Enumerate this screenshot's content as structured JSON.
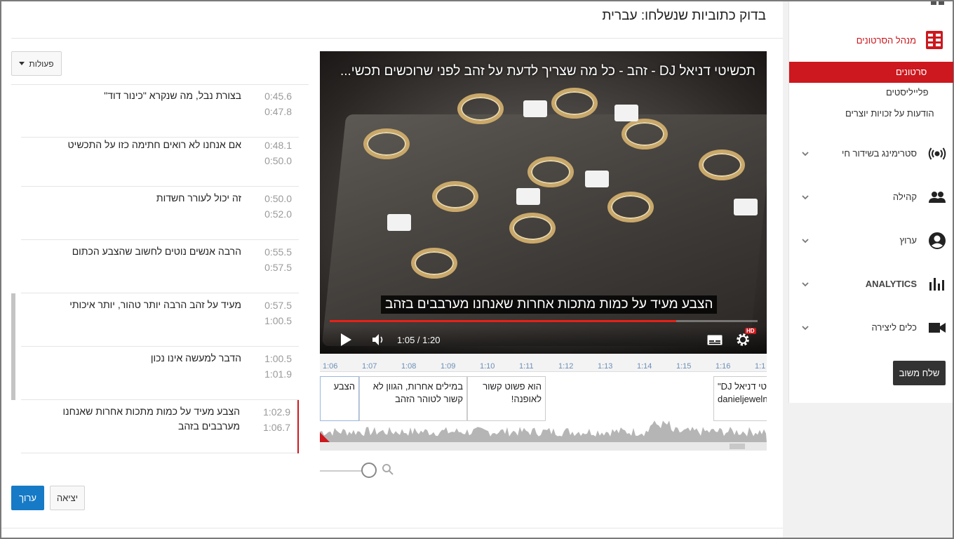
{
  "page": {
    "title": "בדוק כתוביות שנשלחו: עברית",
    "actions_label": "פעולות",
    "exit_label": "יציאה",
    "edit_label": "ערוך"
  },
  "captions": [
    {
      "text": "בצורת נבל, מה שנקרא \"כינור דוד\"",
      "start": "0:45.6",
      "end": "0:47.8"
    },
    {
      "text": "אם אנחנו לא רואים חתימה כזו על התכשיט",
      "start": "0:48.1",
      "end": "0:50.0"
    },
    {
      "text": "זה יכול לעורר חשדות",
      "start": "0:50.0",
      "end": "0:52.0"
    },
    {
      "text": "הרבה אנשים נוטים לחשוב שהצבע הכתום",
      "start": "0:55.5",
      "end": "0:57.5"
    },
    {
      "text": "מעיד על זהב הרבה יותר טהור, יותר איכותי",
      "start": "0:57.5",
      "end": "1:00.5"
    },
    {
      "text": "הדבר למעשה אינו נכון",
      "start": "1:00.5",
      "end": "1:01.9"
    },
    {
      "text": "הצבע מעיד על כמות מתכות אחרות שאנחנו מערבבים בזהב",
      "start": "1:02.9",
      "end": "1:06.7"
    }
  ],
  "player": {
    "video_title": "תכשיטי דניאל DJ - זהב - כל מה שצריך לדעת על זהב לפני שרוכשים תכשי...",
    "subtitle": "הצבע מעיד על כמות מתכות אחרות שאנחנו מערבבים בזהב",
    "time": "1:05 / 1:20",
    "progress": 0.81,
    "hd": "HD"
  },
  "timeline": {
    "ticks": [
      "1:06",
      "1:07",
      "1:08",
      "1:09",
      "1:10",
      "1:11",
      "1:12",
      "1:13",
      "1:14",
      "1:15",
      "1:16",
      "1:1"
    ],
    "cues": [
      {
        "text": "הצבע"
      },
      {
        "text": "במילים אחרות, הגוון לא קשור לטוהר הזהב"
      },
      {
        "text": "הוא פשוט קשור לאופנה!"
      },
      {
        "text": "\"DJ יטי דניאל danieljeweln"
      }
    ]
  },
  "sidebar": {
    "manager_label": "מנהל הסרטונים",
    "videos_label": "סרטונים",
    "playlists_label": "פלייליסטים",
    "copyright_label": "הודעות על זכויות יוצרים",
    "items": [
      {
        "label": "סטרימינג בשידור חי",
        "icon": "live-broadcast-icon"
      },
      {
        "label": "קהילה",
        "icon": "people-icon"
      },
      {
        "label": "ערוץ",
        "icon": "account-circle-icon"
      },
      {
        "label": "ANALYTICS",
        "icon": "bar-chart-icon"
      },
      {
        "label": "כלים ליצירה",
        "icon": "video-camera-icon"
      }
    ],
    "feedback_label": "שלח משוב"
  },
  "colors": {
    "accent": "#cc181e",
    "primary_button": "#167ac6",
    "time_text": "#9a9a9a"
  }
}
